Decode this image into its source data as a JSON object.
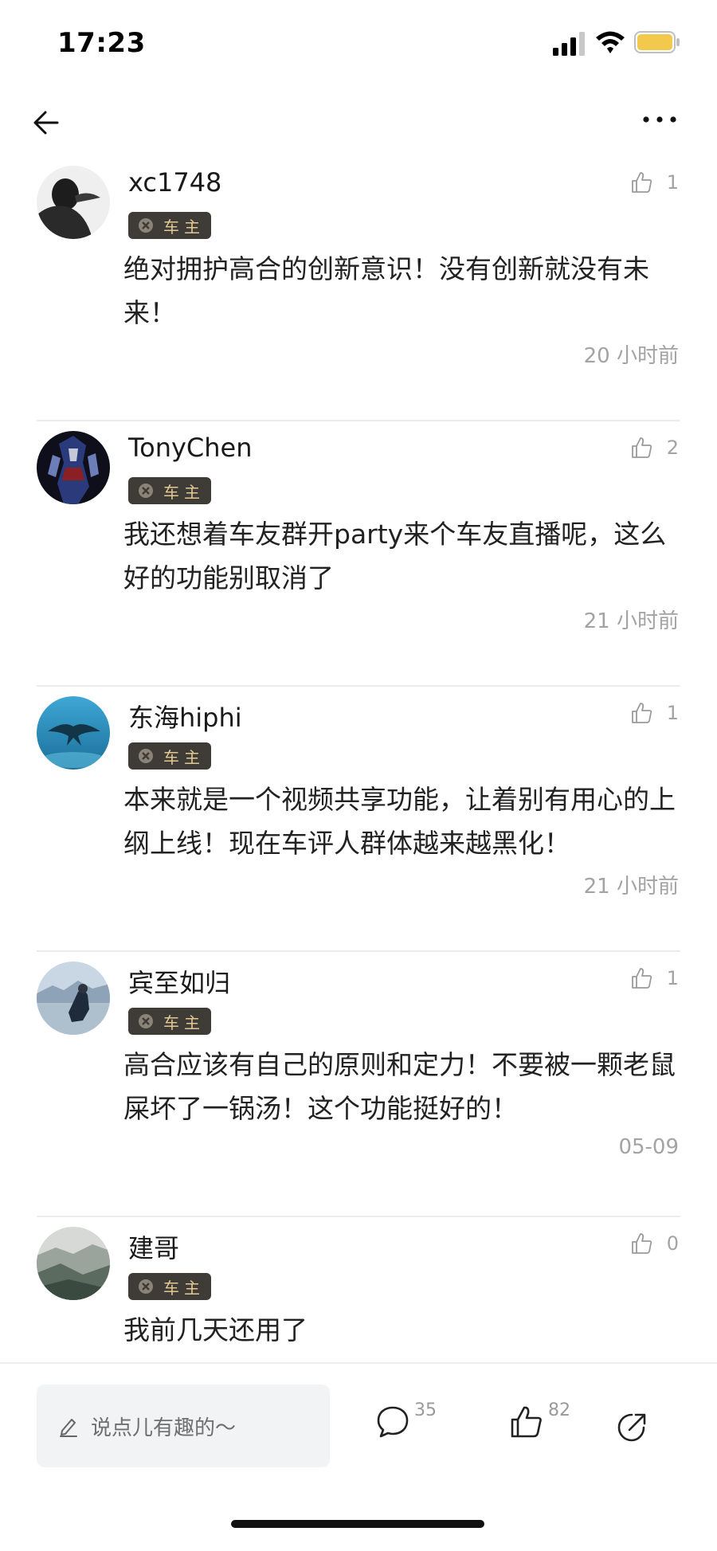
{
  "status_bar": {
    "time": "17:23",
    "icons": [
      "signal-icon",
      "wifi-icon",
      "battery-icon"
    ]
  },
  "nav": {
    "icons": [
      "back-arrow-icon",
      "more-options-icon"
    ]
  },
  "badge_label": "车主",
  "comments": [
    {
      "username": "xc1748",
      "likes": "1",
      "text": "绝对拥护高合的创新意识！没有创新就没有未来！",
      "time": "20 小时前"
    },
    {
      "username": "TonyChen",
      "likes": "2",
      "text": "我还想着车友群开party来个车友直播呢，这么好的功能别取消了",
      "time": "21 小时前"
    },
    {
      "username": "东海hiphi",
      "likes": "1",
      "text": "本来就是一个视频共享功能，让着别有用心的上纲上线！现在车评人群体越来越黑化！",
      "time": "21 小时前"
    },
    {
      "username": "宾至如归",
      "likes": "1",
      "text": "高合应该有自己的原则和定力！不要被一颗老鼠屎坏了一锅汤！这个功能挺好的！",
      "time": "05-09"
    },
    {
      "username": "建哥",
      "likes": "0",
      "text": "我前几天还用了",
      "time": ""
    }
  ],
  "bottom_bar": {
    "input_placeholder": "说点儿有趣的～",
    "comment_count": "35",
    "like_count": "82",
    "icons": [
      "pencil-icon",
      "comment-bubble-icon",
      "thumb-up-icon",
      "share-icon"
    ]
  },
  "colors": {
    "badge_bg": "#3f3b37",
    "badge_text": "#e2c893",
    "muted_text": "#a3a3a3",
    "battery": "#f2c94c"
  }
}
